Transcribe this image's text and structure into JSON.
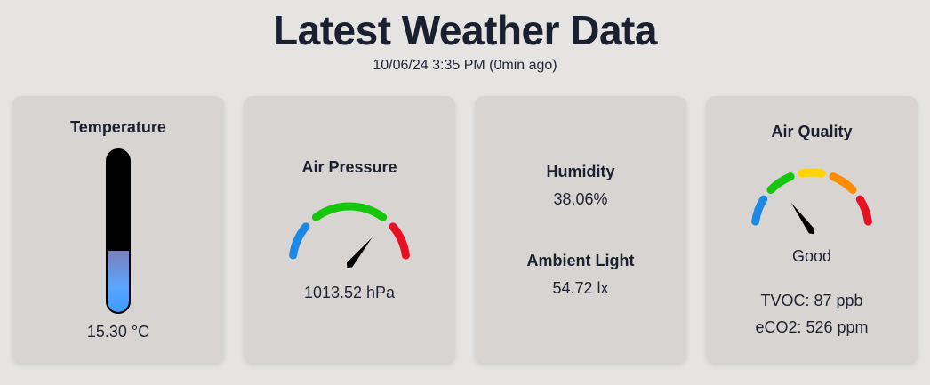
{
  "header": {
    "title": "Latest Weather Data",
    "timestamp": "10/06/24 3:35 PM (0min ago)"
  },
  "temperature": {
    "label": "Temperature",
    "value_text": "15.30 °C",
    "fill_fraction": 0.38,
    "icon": "thermometer-icon"
  },
  "pressure": {
    "label": "Air Pressure",
    "value_text": "1013.52 hPa",
    "needle_fraction": 0.72,
    "segment_colors": [
      "#1e88e5",
      "#16c60c",
      "#e81123"
    ],
    "icon": "pressure-gauge-icon"
  },
  "humidity": {
    "label": "Humidity",
    "value_text": "38.06%"
  },
  "light": {
    "label": "Ambient Light",
    "value_text": "54.72 lx"
  },
  "air_quality": {
    "label": "Air Quality",
    "status": "Good",
    "tvoc_text": "TVOC: 87 ppb",
    "eco2_text": "eCO2: 526 ppm",
    "needle_fraction": 0.3,
    "segment_colors": [
      "#1e88e5",
      "#16c60c",
      "#ffd400",
      "#ff8c00",
      "#e81123"
    ],
    "icon": "air-quality-gauge-icon"
  }
}
